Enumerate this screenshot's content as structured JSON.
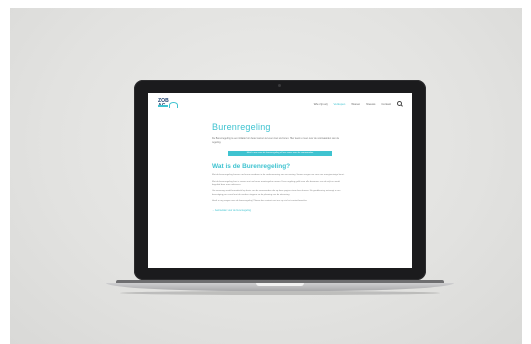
{
  "nav": {
    "logo": "ZOB AG",
    "items": [
      "Wie zijn wij",
      "Verkopen",
      "Wonen",
      "Nieuws",
      "Contact"
    ],
    "active_index": 1
  },
  "page": {
    "title": "Burenregeling",
    "intro": "De Burenregeling is een initiatief om beter samen te leven met uw buren. Hier leest u meer over de voorwaarden van de regeling.",
    "cta": "Meld u aan voor de burenregeling of lees meer over de voorwaarden",
    "section_title": "Wat is de Burenregeling?",
    "paragraphs": [
      "Met de burenregeling kunnen uw buren meedoen in de verduurzaming van uw woning. Samen zorgen we voor een energiezuinige buurt.",
      "Met de burenregeling kunt u samen met uw buren maatregelen nemen. Deze regeling geldt voor alle bewoners van de wijk en wordt begeleid door onze adviseurs.",
      "Uw aanvraag wordt beoordeeld op basis van de voorwaarden die op deze pagina staan beschreven. Na goedkeuring ontvangt u een bevestiging per e-mail met de verdere stappen en de planning van de uitvoering.",
      "Heeft u nog vragen over de burenregeling? Neem dan contact met ons op via het contactformulier."
    ],
    "more_link": "→ Aanmelden voor de burenregeling"
  },
  "colors": {
    "accent": "#3fc3d0",
    "logo_dark": "#1d3f6e",
    "wall": "#e3e3e1",
    "bezel": "#1b1b1d"
  }
}
